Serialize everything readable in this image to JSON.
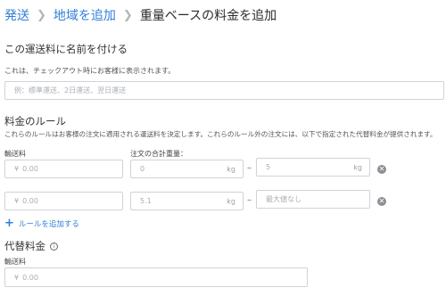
{
  "breadcrumb": {
    "items": [
      "発送",
      "地域を追加"
    ],
    "current": "重量ベースの料金を追加"
  },
  "name_section": {
    "title": "この運送料に名前を付ける",
    "description": "これは、チェックアウト時にお客様に表示されます。",
    "placeholder": "例：標準運送、2日運送、翌日運送"
  },
  "rules_section": {
    "title": "料金のルール",
    "description": "これらのルールはお客様の注文に適用される運送料を決定します。これらのルール外の注文には、以下で指定された代替料金が提供されます。",
    "col_rate_label": "輸送料",
    "col_weight_label": "注文の合計重量：",
    "rows": [
      {
        "rate_prefix": "¥",
        "rate_placeholder": "0.00",
        "min_weight": "0",
        "min_unit": "kg",
        "max_weight": "5",
        "max_unit": "kg"
      },
      {
        "rate_prefix": "¥",
        "rate_placeholder": "0.00",
        "min_weight": "5.1",
        "min_unit": "kg",
        "max_weight": "最大値なし",
        "max_unit": ""
      }
    ],
    "range_separator": "–",
    "add_rule_label": "ルールを追加する"
  },
  "fallback_section": {
    "title": "代替料金",
    "rate_label": "輸送料",
    "rate_prefix": "¥",
    "rate_placeholder": "0.00"
  },
  "icons": {
    "remove": "remove-circle-icon",
    "info": "info-icon",
    "add": "plus-icon",
    "chevron": "chevron-right-icon"
  },
  "colors": {
    "link": "#2f7fd6",
    "input_border": "#cfd3d8",
    "remove_icon": "#8d8f93"
  }
}
